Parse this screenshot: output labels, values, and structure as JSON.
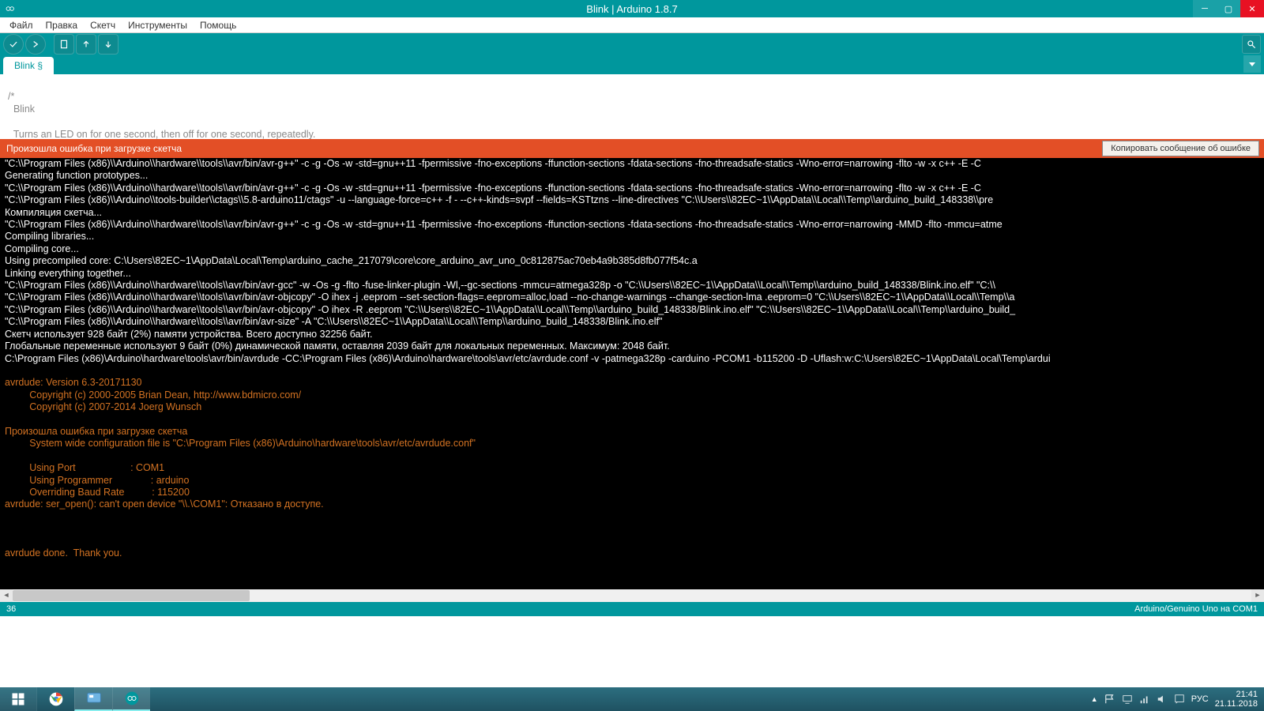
{
  "window": {
    "title": "Blink | Arduino 1.8.7"
  },
  "menu": {
    "file": "Файл",
    "edit": "Правка",
    "sketch": "Скетч",
    "tools": "Инструменты",
    "help": "Помощь"
  },
  "tab": {
    "name": "Blink §"
  },
  "editor": {
    "l1": "/*",
    "l2": "  Blink",
    "l3": "",
    "l4": "  Turns an LED on for one second, then off for one second, repeatedly."
  },
  "errorbar": {
    "message": "Произошла ошибка при загрузке скетча",
    "copy_btn": "Копировать сообщение об ошибке"
  },
  "console": {
    "lines_white": [
      "\"C:\\\\Program Files (x86)\\\\Arduino\\\\hardware\\\\tools\\\\avr/bin/avr-g++\" -c -g -Os -w -std=gnu++11 -fpermissive -fno-exceptions -ffunction-sections -fdata-sections -fno-threadsafe-statics -Wno-error=narrowing -flto -w -x c++ -E -C",
      "Generating function prototypes...",
      "\"C:\\\\Program Files (x86)\\\\Arduino\\\\hardware\\\\tools\\\\avr/bin/avr-g++\" -c -g -Os -w -std=gnu++11 -fpermissive -fno-exceptions -ffunction-sections -fdata-sections -fno-threadsafe-statics -Wno-error=narrowing -flto -w -x c++ -E -C",
      "\"C:\\\\Program Files (x86)\\\\Arduino\\\\tools-builder\\\\ctags\\\\5.8-arduino11/ctags\" -u --language-force=c++ -f - --c++-kinds=svpf --fields=KSTtzns --line-directives \"C:\\\\Users\\\\82EC~1\\\\AppData\\\\Local\\\\Temp\\\\arduino_build_148338\\\\pre",
      "Компиляция скетча...",
      "\"C:\\\\Program Files (x86)\\\\Arduino\\\\hardware\\\\tools\\\\avr/bin/avr-g++\" -c -g -Os -w -std=gnu++11 -fpermissive -fno-exceptions -ffunction-sections -fdata-sections -fno-threadsafe-statics -Wno-error=narrowing -MMD -flto -mmcu=atme",
      "Compiling libraries...",
      "Compiling core...",
      "Using precompiled core: C:\\Users\\82EC~1\\AppData\\Local\\Temp\\arduino_cache_217079\\core\\core_arduino_avr_uno_0c812875ac70eb4a9b385d8fb077f54c.a",
      "Linking everything together...",
      "\"C:\\\\Program Files (x86)\\\\Arduino\\\\hardware\\\\tools\\\\avr/bin/avr-gcc\" -w -Os -g -flto -fuse-linker-plugin -Wl,--gc-sections -mmcu=atmega328p -o \"C:\\\\Users\\\\82EC~1\\\\AppData\\\\Local\\\\Temp\\\\arduino_build_148338/Blink.ino.elf\" \"C:\\\\",
      "\"C:\\\\Program Files (x86)\\\\Arduino\\\\hardware\\\\tools\\\\avr/bin/avr-objcopy\" -O ihex -j .eeprom --set-section-flags=.eeprom=alloc,load --no-change-warnings --change-section-lma .eeprom=0 \"C:\\\\Users\\\\82EC~1\\\\AppData\\\\Local\\\\Temp\\\\a",
      "\"C:\\\\Program Files (x86)\\\\Arduino\\\\hardware\\\\tools\\\\avr/bin/avr-objcopy\" -O ihex -R .eeprom \"C:\\\\Users\\\\82EC~1\\\\AppData\\\\Local\\\\Temp\\\\arduino_build_148338/Blink.ino.elf\" \"C:\\\\Users\\\\82EC~1\\\\AppData\\\\Local\\\\Temp\\\\arduino_build_",
      "\"C:\\\\Program Files (x86)\\\\Arduino\\\\hardware\\\\tools\\\\avr/bin/avr-size\" -A \"C:\\\\Users\\\\82EC~1\\\\AppData\\\\Local\\\\Temp\\\\arduino_build_148338/Blink.ino.elf\"",
      "Скетч использует 928 байт (2%) памяти устройства. Всего доступно 32256 байт.",
      "Глобальные переменные используют 9 байт (0%) динамической памяти, оставляя 2039 байт для локальных переменных. Максимум: 2048 байт.",
      "C:\\Program Files (x86)\\Arduino\\hardware\\tools\\avr/bin/avrdude -CC:\\Program Files (x86)\\Arduino\\hardware\\tools\\avr/etc/avrdude.conf -v -patmega328p -carduino -PCOM1 -b115200 -D -Uflash:w:C:\\Users\\82EC~1\\AppData\\Local\\Temp\\ardui",
      ""
    ],
    "lines_orange": [
      "avrdude: Version 6.3-20171130",
      "         Copyright (c) 2000-2005 Brian Dean, http://www.bdmicro.com/",
      "         Copyright (c) 2007-2014 Joerg Wunsch",
      "",
      "Произошла ошибка при загрузке скетча",
      "         System wide configuration file is \"C:\\Program Files (x86)\\Arduino\\hardware\\tools\\avr/etc/avrdude.conf\"",
      "",
      "         Using Port                    : COM1",
      "         Using Programmer              : arduino",
      "         Overriding Baud Rate          : 115200",
      "avrdude: ser_open(): can't open device \"\\\\.\\COM1\": Отказано в доступе.",
      "",
      "",
      "",
      "avrdude done.  Thank you.",
      ""
    ]
  },
  "status": {
    "left": "36",
    "right": "Arduino/Genuino Uno на COM1"
  },
  "taskbar": {
    "lang": "РУС",
    "time": "21:41",
    "date": "21.11.2018"
  }
}
